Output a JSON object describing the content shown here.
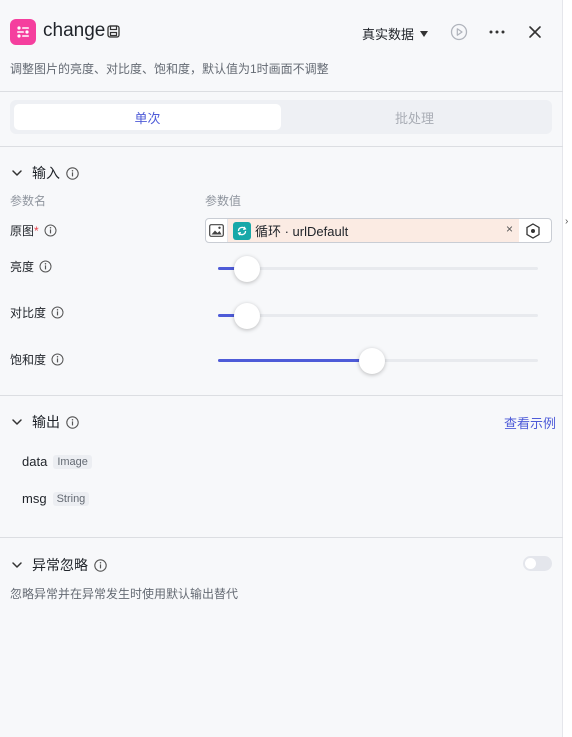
{
  "header": {
    "title": "change",
    "data_mode": "真实数据",
    "description": "调整图片的亮度、对比度、饱和度，默认值为1时画面不调整"
  },
  "tabs": [
    {
      "label": "单次",
      "active": true
    },
    {
      "label": "批处理",
      "active": false
    }
  ],
  "input_section": {
    "title": "输入",
    "col_name": "参数名",
    "col_value": "参数值",
    "params": [
      {
        "label": "原图",
        "required_mark": "*",
        "value_text": "循环 · urlDefault"
      },
      {
        "label": "亮度",
        "level": 0.09
      },
      {
        "label": "对比度",
        "level": 0.09
      },
      {
        "label": "饱和度",
        "level": 0.48
      }
    ]
  },
  "output_section": {
    "title": "输出",
    "example_link": "查看示例",
    "outputs": [
      {
        "name": "data",
        "type": "Image"
      },
      {
        "name": "msg",
        "type": "String"
      }
    ]
  },
  "exception_section": {
    "title": "异常忽略",
    "enabled": false,
    "description": "忽略异常并在异常发生时使用默认输出替代"
  },
  "colors": {
    "accent": "#4e5bd8",
    "brand_icon": "#f53f9e",
    "loop_badge": "#18a8a8",
    "chip_bg": "#fbebe3"
  },
  "icons": {
    "app": "flow-node-icon",
    "save": "save-icon",
    "run": "play-icon",
    "more": "more-icon",
    "close": "close-icon",
    "image": "image-icon",
    "loop": "loop-icon",
    "settings": "hexagon-settings-icon"
  }
}
